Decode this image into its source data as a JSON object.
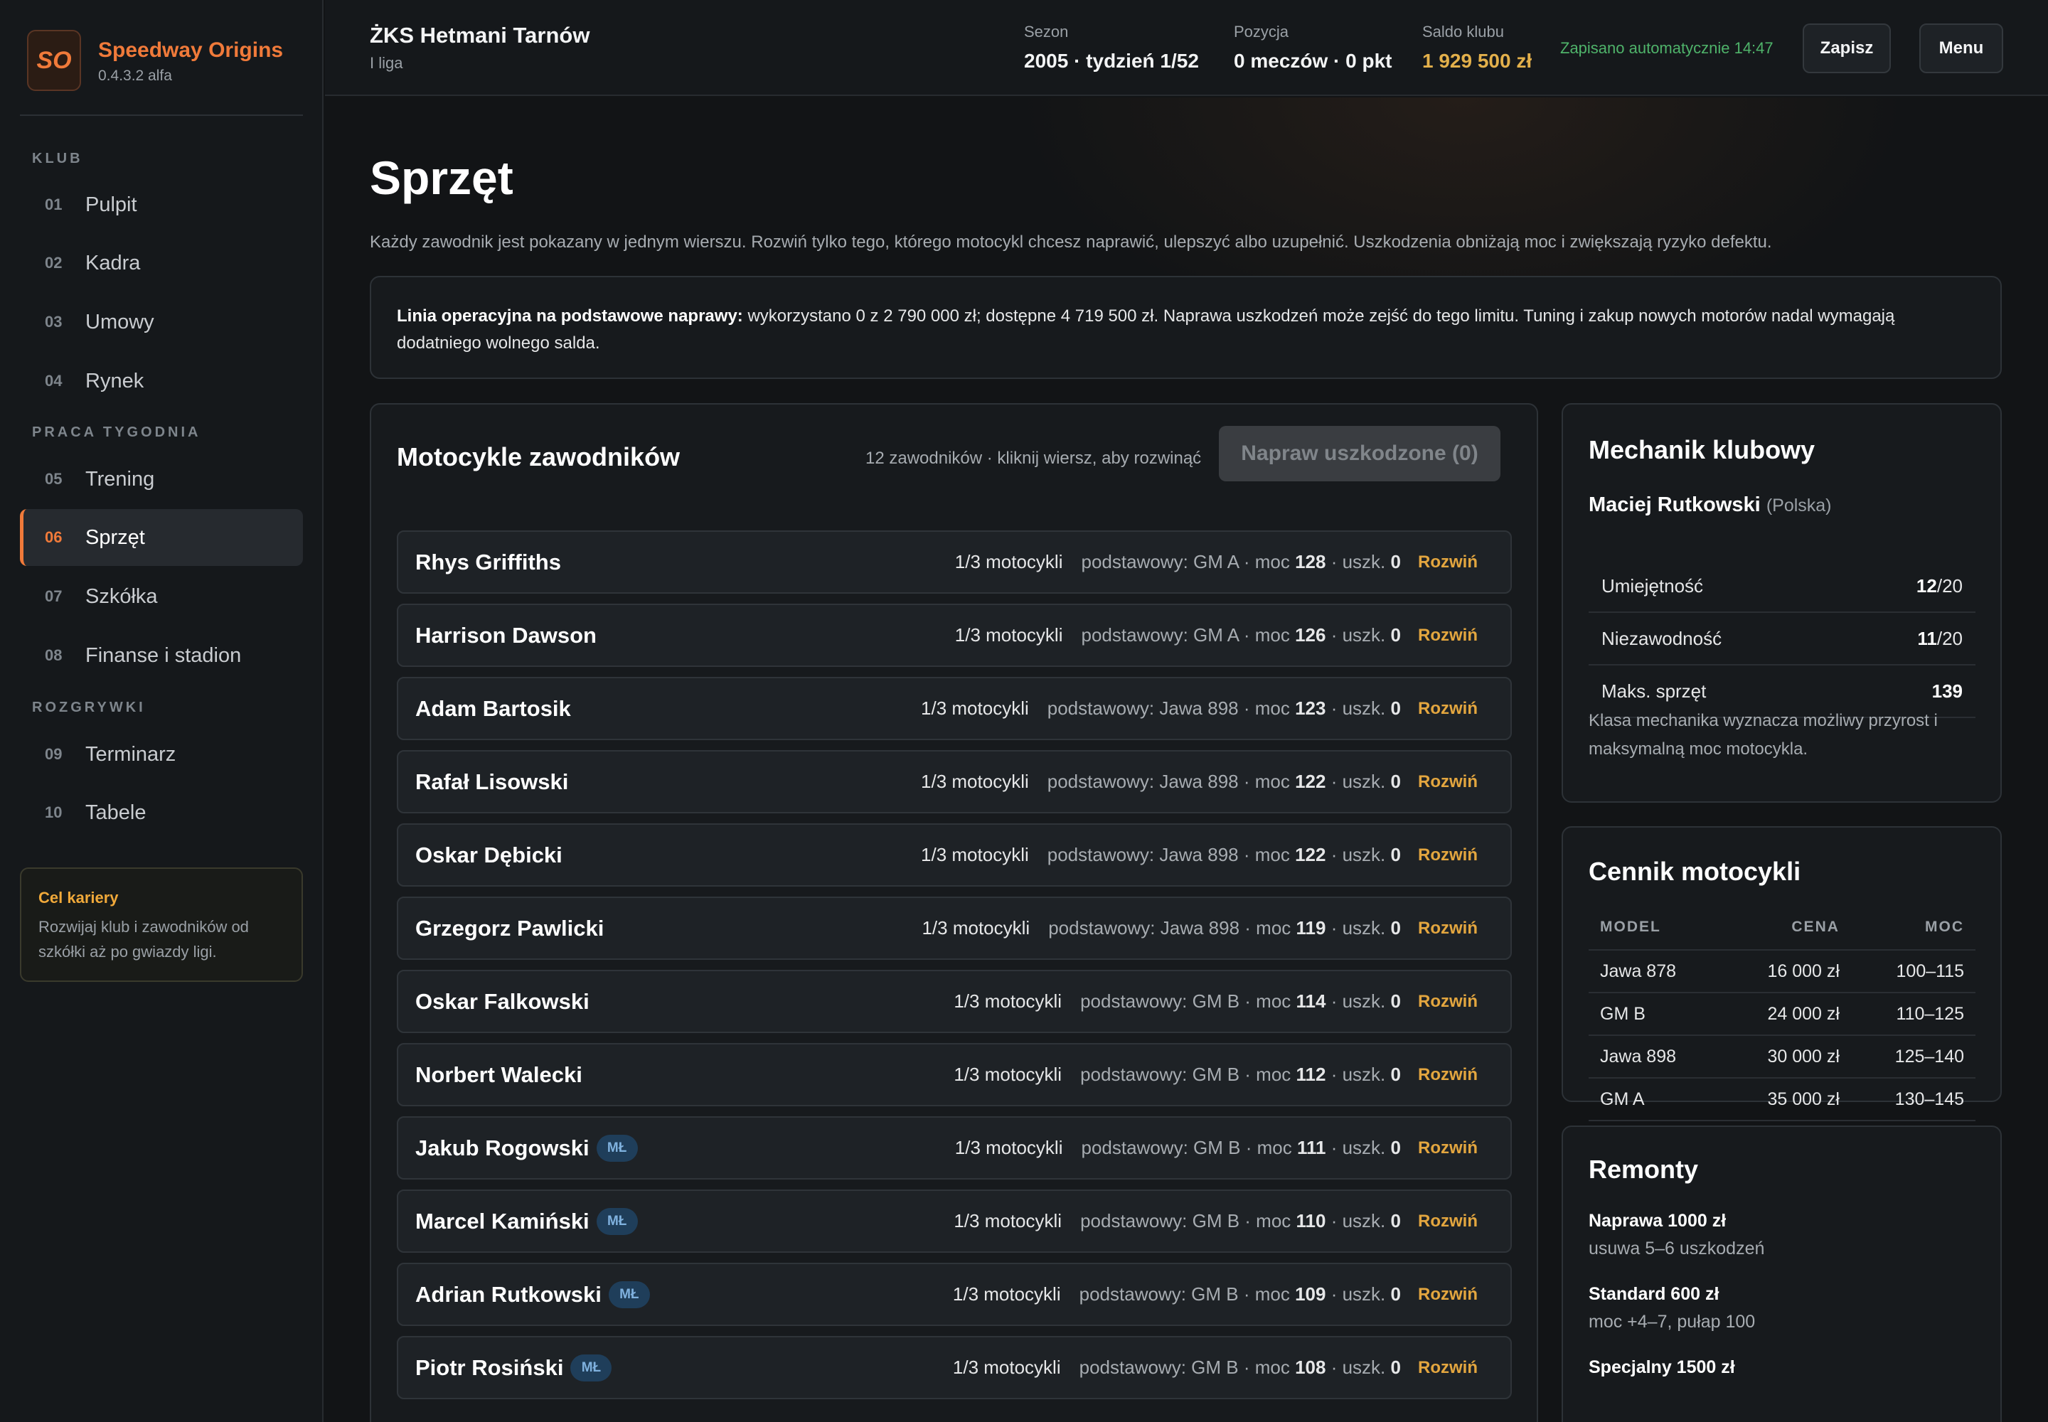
{
  "brand": {
    "logo": "SO",
    "name": "Speedway Origins",
    "version": "0.4.3.2 alfa"
  },
  "nav": {
    "sections": [
      "KLUB",
      "PRACA TYGODNIA",
      "ROZGRYWKI"
    ],
    "items": [
      {
        "num": "01",
        "label": "Pulpit"
      },
      {
        "num": "02",
        "label": "Kadra"
      },
      {
        "num": "03",
        "label": "Umowy"
      },
      {
        "num": "04",
        "label": "Rynek"
      },
      {
        "num": "05",
        "label": "Trening"
      },
      {
        "num": "06",
        "label": "Sprzęt",
        "active": true
      },
      {
        "num": "07",
        "label": "Szkółka"
      },
      {
        "num": "08",
        "label": "Finanse i stadion"
      },
      {
        "num": "09",
        "label": "Terminarz"
      },
      {
        "num": "10",
        "label": "Tabele"
      }
    ]
  },
  "goal": {
    "title": "Cel kariery",
    "text": "Rozwijaj klub i zawodników od szkółki aż po gwiazdy ligi."
  },
  "topbar": {
    "club": "ŻKS Hetmani Tarnów",
    "league": "I liga",
    "season_label": "Sezon",
    "season_value": "2005 · tydzień 1/52",
    "position_label": "Pozycja",
    "position_value": "0 meczów · 0 pkt",
    "balance_label": "Saldo klubu",
    "balance_value": "1 929 500 zł",
    "autosave": "Zapisano automatycznie 14:47",
    "save_label": "Zapisz",
    "menu_label": "Menu"
  },
  "page": {
    "title": "Sprzęt",
    "description": "Każdy zawodnik jest pokazany w jednym wierszu. Rozwiń tylko tego, którego motocykl chcesz naprawić, ulepszyć albo uzupełnić. Uszkodzenia obniżają moc i zwiększają ryzyko defektu.",
    "credit_bold": "Linia operacyjna na podstawowe naprawy:",
    "credit_text": " wykorzystano 0 z 2 790 000 zł; dostępne 4 719 500 zł. Naprawa uszkodzeń może zejść do tego limitu. Tuning i zakup nowych motorów nadal wymagają dodatniego wolnego salda."
  },
  "riders_panel": {
    "title": "Motocykle zawodników",
    "hint": "12 zawodników · kliknij wiersz, aby rozwinąć",
    "repair_button": "Napraw uszkodzone (0)",
    "moto_count": "1/3 motocykli",
    "base_prefix": "podstawowy:",
    "power_prefix": "· moc",
    "damage_prefix": "· uszk.",
    "expand_label": "Rozwiń",
    "junior_badge": "MŁ",
    "riders": [
      {
        "name": "Rhys Griffiths",
        "bike": "GM A",
        "power": "128",
        "damage": "0",
        "junior": false
      },
      {
        "name": "Harrison Dawson",
        "bike": "GM A",
        "power": "126",
        "damage": "0",
        "junior": false
      },
      {
        "name": "Adam Bartosik",
        "bike": "Jawa 898",
        "power": "123",
        "damage": "0",
        "junior": false
      },
      {
        "name": "Rafał Lisowski",
        "bike": "Jawa 898",
        "power": "122",
        "damage": "0",
        "junior": false
      },
      {
        "name": "Oskar Dębicki",
        "bike": "Jawa 898",
        "power": "122",
        "damage": "0",
        "junior": false
      },
      {
        "name": "Grzegorz Pawlicki",
        "bike": "Jawa 898",
        "power": "119",
        "damage": "0",
        "junior": false
      },
      {
        "name": "Oskar Falkowski",
        "bike": "GM B",
        "power": "114",
        "damage": "0",
        "junior": false
      },
      {
        "name": "Norbert Walecki",
        "bike": "GM B",
        "power": "112",
        "damage": "0",
        "junior": false
      },
      {
        "name": "Jakub Rogowski",
        "bike": "GM B",
        "power": "111",
        "damage": "0",
        "junior": true
      },
      {
        "name": "Marcel Kamiński",
        "bike": "GM B",
        "power": "110",
        "damage": "0",
        "junior": true
      },
      {
        "name": "Adrian Rutkowski",
        "bike": "GM B",
        "power": "109",
        "damage": "0",
        "junior": true
      },
      {
        "name": "Piotr Rosiński",
        "bike": "GM B",
        "power": "108",
        "damage": "0",
        "junior": true
      }
    ]
  },
  "mechanic": {
    "title": "Mechanik klubowy",
    "name": "Maciej Rutkowski",
    "country": "(Polska)",
    "rows": [
      {
        "label": "Umiejętność",
        "value": "12",
        "suffix": "/20"
      },
      {
        "label": "Niezawodność",
        "value": "11",
        "suffix": "/20"
      },
      {
        "label": "Maks. sprzęt",
        "value": "139",
        "suffix": ""
      }
    ],
    "note": "Klasa mechanika wyznacza możliwy przyrost i maksymalną moc motocykla."
  },
  "price_list": {
    "title": "Cennik motocykli",
    "headers": [
      "MODEL",
      "CENA",
      "MOC"
    ],
    "rows": [
      [
        "Jawa 878",
        "16 000 zł",
        "100–115"
      ],
      [
        "GM B",
        "24 000 zł",
        "110–125"
      ],
      [
        "Jawa 898",
        "30 000 zł",
        "125–140"
      ],
      [
        "GM A",
        "35 000 zł",
        "130–145"
      ]
    ]
  },
  "repairs": {
    "title": "Remonty",
    "items": [
      {
        "name": "Naprawa 1000 zł",
        "desc": "usuwa 5–6 uszkodzeń"
      },
      {
        "name": "Standard 600 zł",
        "desc": "moc +4–7, pułap 100"
      },
      {
        "name": "Specjalny 1500 zł",
        "desc": ""
      }
    ]
  },
  "colors": {
    "accent": "#f07a3a",
    "money": "#e3b04b",
    "autosave": "#4fb36a",
    "expand": "#e3a63f"
  }
}
